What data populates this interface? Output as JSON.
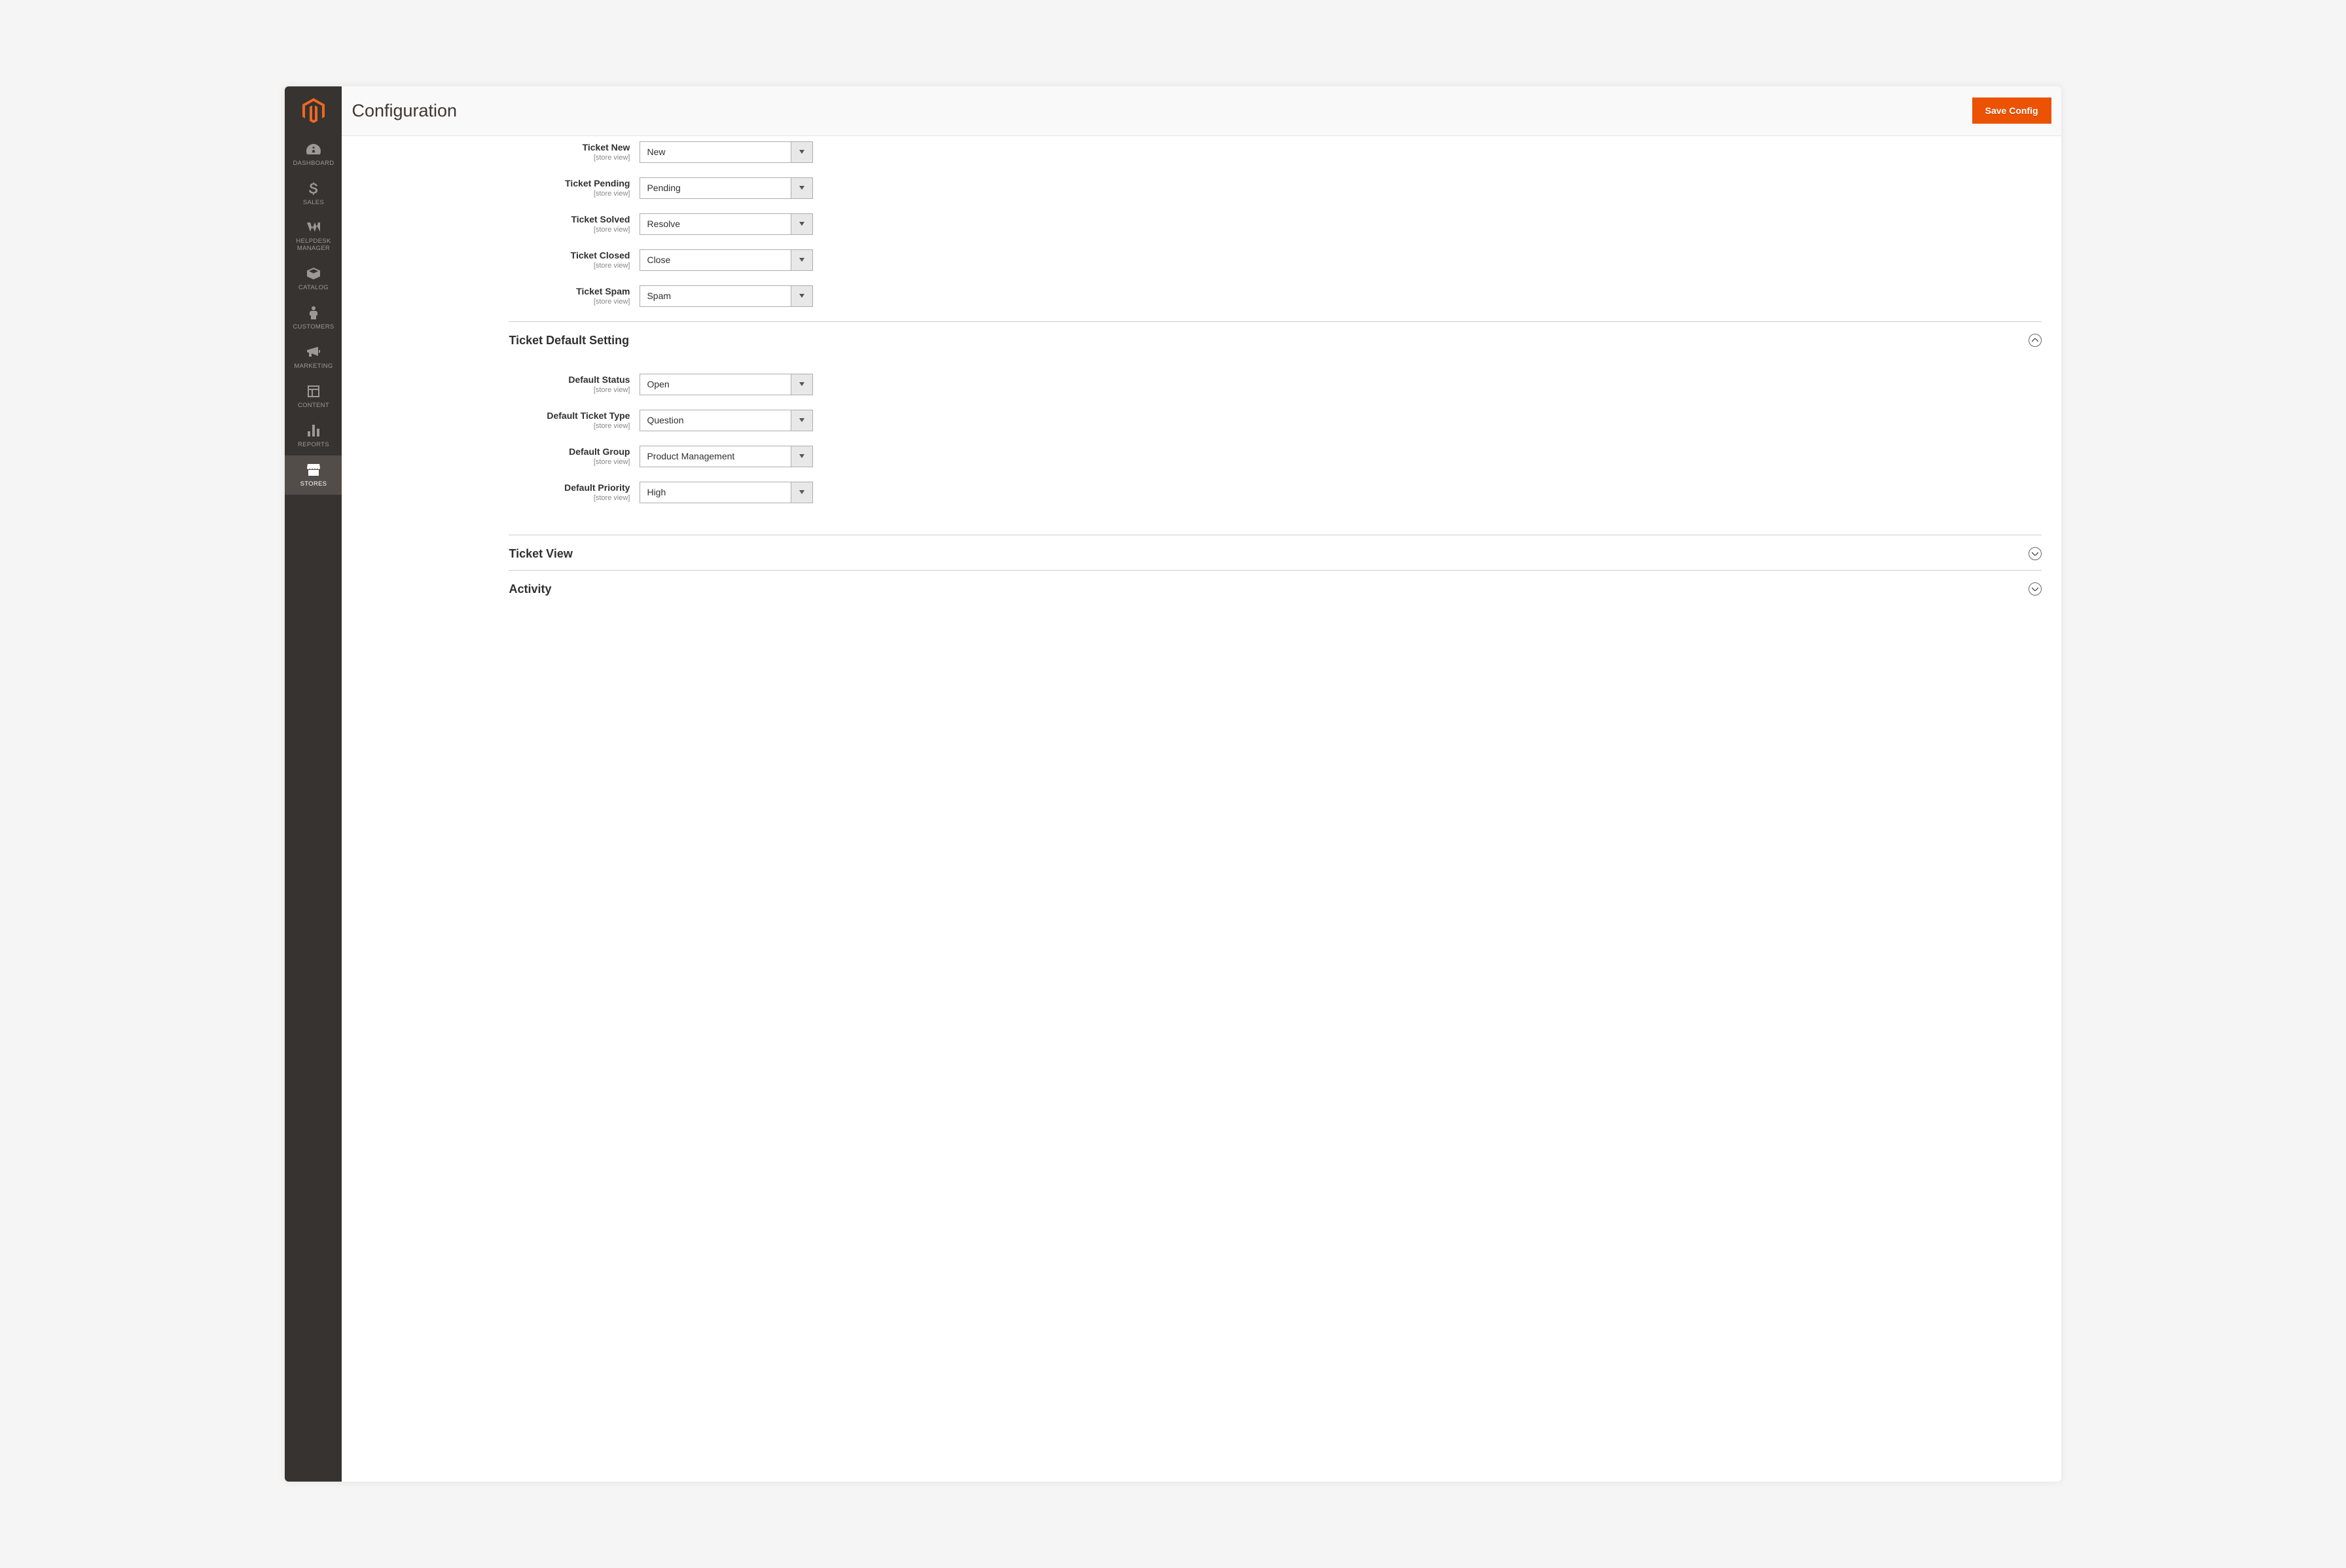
{
  "header": {
    "title": "Configuration",
    "save_label": "Save Config"
  },
  "sidebar": {
    "items": [
      {
        "label": "DASHBOARD",
        "icon": "gauge"
      },
      {
        "label": "SALES",
        "icon": "dollar"
      },
      {
        "label": "HELPDESK MANAGER",
        "icon": "helpdesk"
      },
      {
        "label": "CATALOG",
        "icon": "box"
      },
      {
        "label": "CUSTOMERS",
        "icon": "person"
      },
      {
        "label": "MARKETING",
        "icon": "megaphone"
      },
      {
        "label": "CONTENT",
        "icon": "layout"
      },
      {
        "label": "REPORTS",
        "icon": "bars"
      },
      {
        "label": "STORES",
        "icon": "storefront",
        "active": true
      }
    ]
  },
  "scope_label": "[store view]",
  "status_fields": [
    {
      "label": "Ticket New",
      "value": "New",
      "key": "ticket-new"
    },
    {
      "label": "Ticket Pending",
      "value": "Pending",
      "key": "ticket-pending"
    },
    {
      "label": "Ticket Solved",
      "value": "Resolve",
      "key": "ticket-solved"
    },
    {
      "label": "Ticket Closed",
      "value": "Close",
      "key": "ticket-closed"
    },
    {
      "label": "Ticket Spam",
      "value": "Spam",
      "key": "ticket-spam"
    }
  ],
  "sections": {
    "default": {
      "title": "Ticket Default Setting",
      "fields": [
        {
          "label": "Default Status",
          "value": "Open",
          "key": "default-status"
        },
        {
          "label": "Default Ticket Type",
          "value": "Question",
          "key": "default-ticket-type"
        },
        {
          "label": "Default Group",
          "value": "Product Management",
          "key": "default-group"
        },
        {
          "label": "Default Priority",
          "value": "High",
          "key": "default-priority"
        }
      ]
    },
    "view": {
      "title": "Ticket View"
    },
    "activity": {
      "title": "Activity"
    }
  }
}
